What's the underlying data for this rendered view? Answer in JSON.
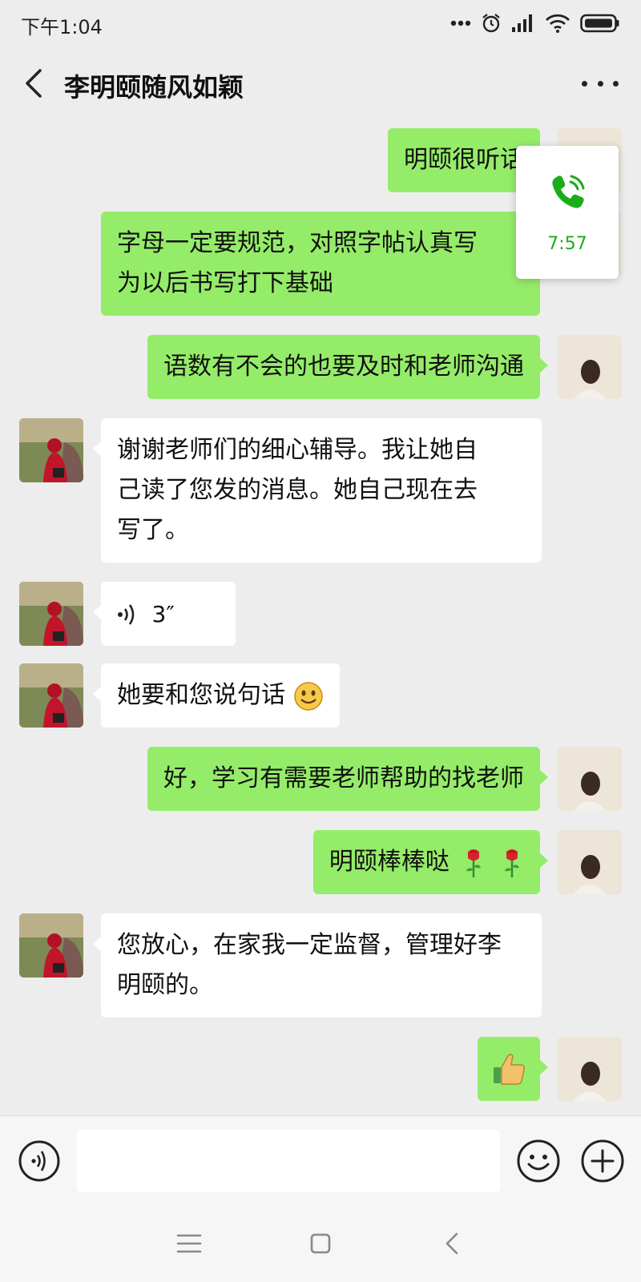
{
  "status_bar": {
    "time": "下午1:04",
    "icons": [
      "dots-icon",
      "alarm-icon",
      "signal-icon",
      "wifi-icon",
      "battery-icon"
    ]
  },
  "header": {
    "title": "李明颐随风如颖",
    "back_icon": "chevron-left-icon",
    "more_icon": "more-dots-icon"
  },
  "call_float": {
    "icon": "phone-call-icon",
    "duration": "7:57"
  },
  "messages": [
    {
      "from": "self",
      "type": "text",
      "lines": [
        "明颐很听话"
      ]
    },
    {
      "from": "self",
      "type": "text",
      "lines": [
        "字母一定要规范，对照字帖认真写",
        "为以后书写打下基础"
      ]
    },
    {
      "from": "self",
      "type": "text",
      "lines": [
        "语数有不会的也要及时和老师沟通"
      ]
    },
    {
      "from": "other",
      "type": "text",
      "lines": [
        "谢谢老师们的细心辅导。我让她自",
        "己读了您发的消息。她自己现在去",
        "写了。"
      ]
    },
    {
      "from": "other",
      "type": "voice",
      "duration": "3″"
    },
    {
      "from": "other",
      "type": "text",
      "lines": [
        "她要和您说句话"
      ],
      "emoji": "smile-emoji"
    },
    {
      "from": "self",
      "type": "text",
      "lines": [
        "好，学习有需要老师帮助的找老师"
      ]
    },
    {
      "from": "self",
      "type": "text",
      "lines": [
        "明颐棒棒哒"
      ],
      "emoji": "rose-emoji ×2"
    },
    {
      "from": "other",
      "type": "text",
      "lines": [
        "您放心，在家我一定监督，管理好李",
        "明颐的。"
      ]
    },
    {
      "from": "self",
      "type": "sticker",
      "emoji": "thumbs-up-emoji"
    }
  ],
  "input_bar": {
    "text_value": "",
    "voice_icon": "voice-input-icon",
    "emoji_icon": "emoji-icon",
    "plus_icon": "plus-icon"
  },
  "system_nav": [
    "menu-icon",
    "home-icon",
    "back-icon"
  ],
  "colors": {
    "background": "#ededed",
    "outgoing_bubble": "#95ec69",
    "incoming_bubble": "#ffffff",
    "call_green": "#1aad19"
  }
}
